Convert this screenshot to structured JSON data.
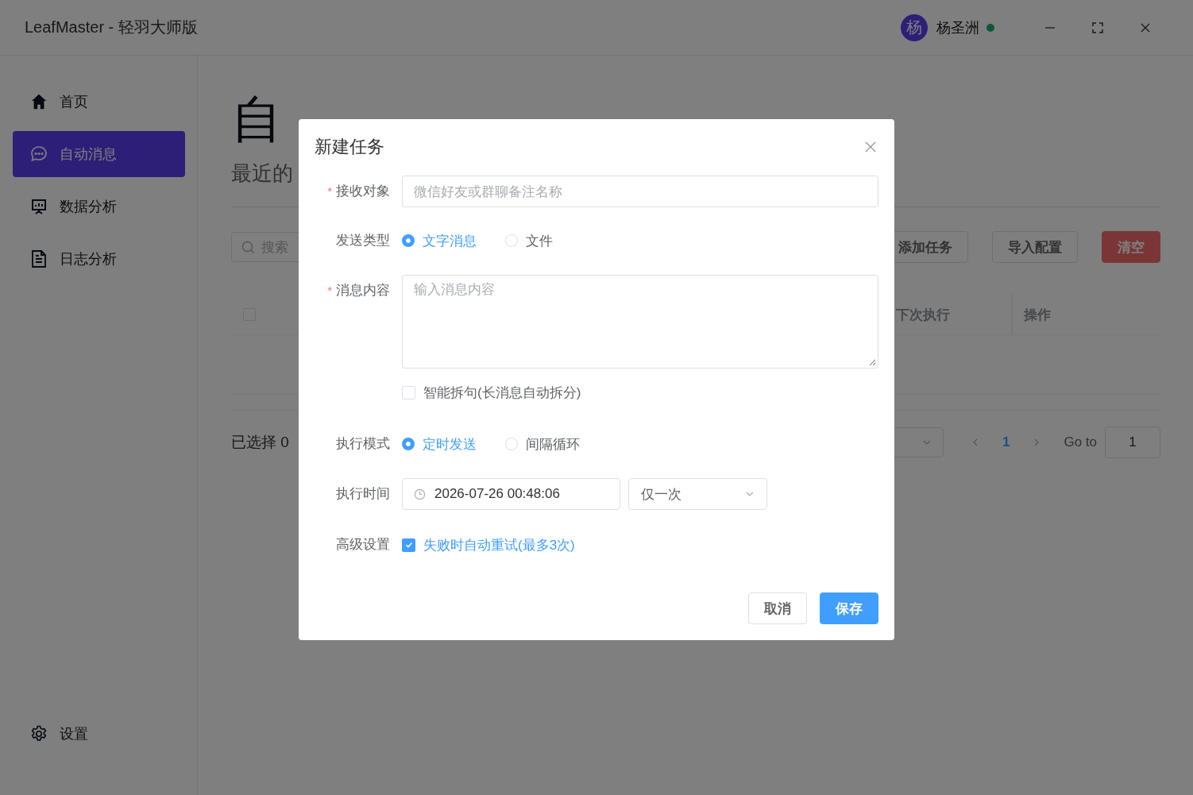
{
  "window": {
    "title": "LeafMaster - 轻羽大师版",
    "user": {
      "avatar": "杨",
      "name": "杨圣洲",
      "online": true
    }
  },
  "sidebar": {
    "items": [
      {
        "label": "首页",
        "selected": false
      },
      {
        "label": "自动消息",
        "selected": true
      },
      {
        "label": "数据分析",
        "selected": false
      },
      {
        "label": "日志分析",
        "selected": false
      }
    ],
    "footer": {
      "label": "设置"
    }
  },
  "page": {
    "title": "自",
    "subtitle": "最近的",
    "search": {
      "placeholder": "搜索"
    },
    "buttons": [
      {
        "label": "添加任务",
        "kind": "default"
      },
      {
        "label": "导入配置",
        "kind": "default"
      },
      {
        "label": "清空",
        "kind": "danger"
      }
    ],
    "table": {
      "select_all": {
        "checked": false
      },
      "columns": [
        {
          "label": "下次执行"
        },
        {
          "label": "操作"
        }
      ]
    },
    "selection_summary": "已选择 0",
    "pagination": {
      "pages": [
        {
          "label": "1",
          "selected": true
        }
      ],
      "goto_label": "Go to",
      "goto_value": "1"
    }
  },
  "dialog": {
    "title": "新建任务",
    "fields": [
      {
        "kind": "input",
        "required_mark": "*",
        "label": "接收对象",
        "placeholder": "微信好友或群聊备注名称"
      },
      {
        "kind": "radio",
        "label": "发送类型",
        "options": [
          {
            "label": "文字消息",
            "selected": true
          },
          {
            "label": "文件",
            "selected": false
          }
        ]
      },
      {
        "kind": "textarea",
        "required_mark": "*",
        "label": "消息内容",
        "placeholder": "输入消息内容"
      },
      {
        "kind": "checkbox",
        "text": "智能拆句(长消息自动拆分)",
        "checked": false
      },
      {
        "kind": "radio",
        "label": "执行模式",
        "options": [
          {
            "label": "定时发送",
            "selected": true
          },
          {
            "label": "间隔循环",
            "selected": false
          }
        ]
      },
      {
        "kind": "datetime",
        "label": "执行时间",
        "value": "2026-07-26 00:48:06",
        "repeat": "仅一次"
      },
      {
        "kind": "checkbox",
        "label": "高级设置",
        "text": "失败时自动重试(最多3次)",
        "checked": true
      }
    ],
    "buttons": [
      {
        "label": "取消",
        "kind": "default"
      },
      {
        "label": "保存",
        "kind": "primary"
      }
    ]
  }
}
